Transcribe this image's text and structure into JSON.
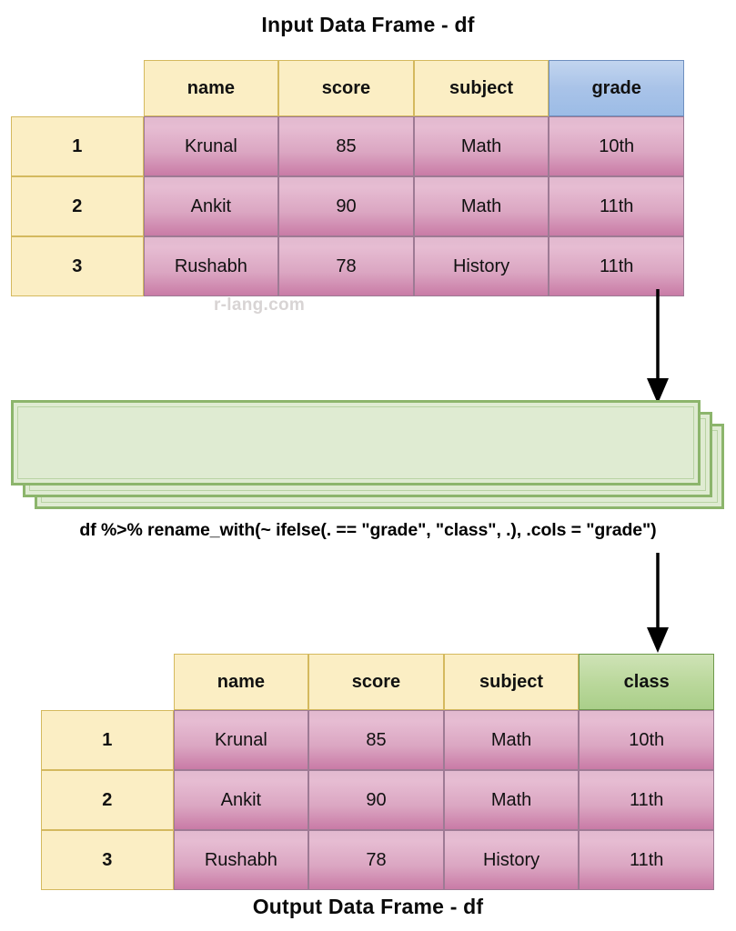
{
  "input": {
    "title": "Input Data Frame - df",
    "columns": [
      "name",
      "score",
      "subject",
      "grade"
    ],
    "highlight_column": "grade",
    "highlight_color": "#a9c3e8",
    "index": [
      "1",
      "2",
      "3"
    ],
    "rows": [
      [
        "Krunal",
        "85",
        "Math",
        "10th"
      ],
      [
        "Ankit",
        "90",
        "Math",
        "11th"
      ],
      [
        "Rushabh",
        "78",
        "History",
        "11th"
      ]
    ]
  },
  "output": {
    "title": "Output Data Frame - df",
    "columns": [
      "name",
      "score",
      "subject",
      "class"
    ],
    "highlight_column": "class",
    "highlight_color": "#b9d79a",
    "index": [
      "1",
      "2",
      "3"
    ],
    "rows": [
      [
        "Krunal",
        "85",
        "Math",
        "10th"
      ],
      [
        "Ankit",
        "90",
        "Math",
        "11th"
      ],
      [
        "Rushabh",
        "78",
        "History",
        "11th"
      ]
    ]
  },
  "code": {
    "text": "df %>% rename_with(~ ifelse(. == \"grade\", \"class\", .), .cols = \"grade\")"
  },
  "watermark": {
    "text": "r-lang.com"
  },
  "arrows": {
    "top_label": "down-arrow",
    "bottom_label": "down-arrow"
  },
  "colors": {
    "header_cream": "#fbeec4",
    "header_cream_border": "#d4b95e",
    "cell_pink_top": "#e2b9cf",
    "cell_pink_bottom": "#c97ba6",
    "cell_border": "#9d7a94",
    "green_sheet_fill": "#dfebd2",
    "green_sheet_border": "#8cb56c",
    "blue_header": "#a9c3e8",
    "green_header": "#b9d79a",
    "watermark_gray": "#d8d4d4"
  }
}
